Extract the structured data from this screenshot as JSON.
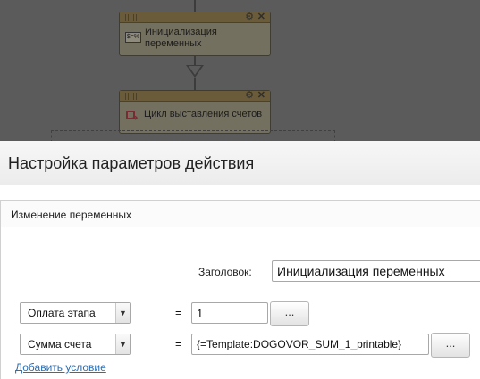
{
  "canvas": {
    "blocks": [
      {
        "icon_text": "$=%",
        "title_line1": "Инициализация",
        "title_line2": "переменных"
      },
      {
        "title": "Цикл выставления счетов"
      }
    ]
  },
  "dialog": {
    "title": "Настройка параметров действия",
    "section_title": "Изменение переменных",
    "title_label": "Заголовок:",
    "title_value": "Инициализация переменных",
    "rows": [
      {
        "variable": "Оплата этапа",
        "operator": "=",
        "value": "1",
        "button_label": "..."
      },
      {
        "variable": "Сумма счета",
        "operator": "=",
        "value": "{=Template:DOGOVOR_SUM_1_printable}",
        "button_label": "..."
      }
    ],
    "add_condition_label": "Добавить условие"
  },
  "colors": {
    "overlay": "#5b5b5b",
    "link": "#2a6fb5"
  }
}
